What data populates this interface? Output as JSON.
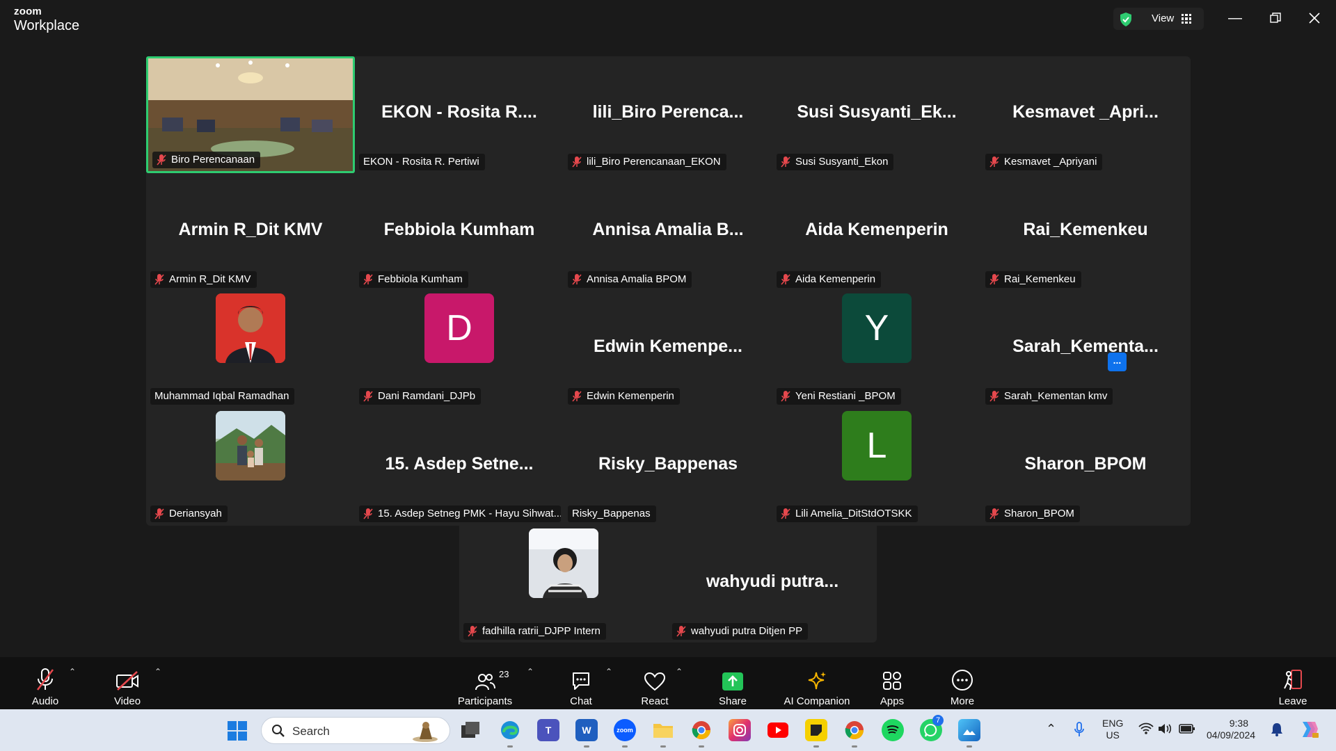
{
  "window": {
    "brand_top": "zoom",
    "brand_bottom": "Workplace",
    "view_label": "View",
    "controls": [
      "minimize",
      "restore",
      "close"
    ]
  },
  "gallery": {
    "tiles": [
      {
        "display": "video",
        "label": "Biro Perencanaan",
        "muted": true,
        "active": true
      },
      {
        "display": "name",
        "big_name": "EKON - Rosita R....",
        "label": "EKON - Rosita R. Pertiwi",
        "muted": false
      },
      {
        "display": "name",
        "big_name": "lili_Biro Perenca...",
        "label": "lili_Biro Perencanaan_EKON",
        "muted": true
      },
      {
        "display": "name",
        "big_name": "Susi Susyanti_Ek...",
        "label": "Susi Susyanti_Ekon",
        "muted": true
      },
      {
        "display": "name",
        "big_name": "Kesmavet _Apri...",
        "label": "Kesmavet _Apriyani",
        "muted": true
      },
      {
        "display": "name",
        "big_name": "Armin R_Dit KMV",
        "label": "Armin R_Dit KMV",
        "muted": true
      },
      {
        "display": "name",
        "big_name": "Febbiola Kumham",
        "label": "Febbiola Kumham",
        "muted": true
      },
      {
        "display": "name",
        "big_name": "Annisa Amalia B...",
        "label": "Annisa Amalia BPOM",
        "muted": true
      },
      {
        "display": "name",
        "big_name": "Aida Kemenperin",
        "label": "Aida Kemenperin",
        "muted": true
      },
      {
        "display": "name",
        "big_name": "Rai_Kemenkeu",
        "label": "Rai_Kemenkeu",
        "muted": true
      },
      {
        "display": "photo",
        "label": "Muhammad Iqbal Ramadhan",
        "muted": false
      },
      {
        "display": "initial",
        "initial": "D",
        "color": "#c8186a",
        "label": "Dani Ramdani_DJPb",
        "muted": true
      },
      {
        "display": "name",
        "big_name": "Edwin Kemenpe...",
        "label": "Edwin Kemenperin",
        "muted": true
      },
      {
        "display": "initial",
        "initial": "Y",
        "color": "#0c4a3a",
        "label": "Yeni Restiani _BPOM",
        "muted": true
      },
      {
        "display": "name",
        "big_name": "Sarah_Kementa...",
        "label": "Sarah_Kementan kmv",
        "muted": true
      },
      {
        "display": "photo",
        "label": "Deriansyah",
        "muted": true
      },
      {
        "display": "name",
        "big_name": "15. Asdep Setne...",
        "label": "15. Asdep Setneg PMK - Hayu Sihwat...",
        "muted": true
      },
      {
        "display": "name",
        "big_name": "Risky_Bappenas",
        "label": "Risky_Bappenas",
        "muted": false
      },
      {
        "display": "initial",
        "initial": "L",
        "color": "#2e7d1c",
        "label": "Lili Amelia_DitStdOTSKK",
        "muted": true
      },
      {
        "display": "name",
        "big_name": "Sharon_BPOM",
        "label": "Sharon_BPOM",
        "muted": true
      },
      {
        "display": "photo",
        "label": "fadhilla ratrii_DJPP Intern",
        "muted": true
      },
      {
        "display": "name",
        "big_name": "wahyudi putra...",
        "label": "wahyudi putra Ditjen PP",
        "muted": true
      }
    ],
    "more_button": "..."
  },
  "toolbar": {
    "audio": "Audio",
    "video": "Video",
    "participants": "Participants",
    "participants_count": "23",
    "chat": "Chat",
    "react": "React",
    "share": "Share",
    "ai_companion": "AI Companion",
    "apps": "Apps",
    "more": "More",
    "leave": "Leave"
  },
  "taskbar": {
    "search_placeholder": "Search",
    "apps": [
      "start",
      "file-explorer-task",
      "edge",
      "teams",
      "word",
      "zoom",
      "files",
      "chrome",
      "instagram",
      "youtube",
      "sticky",
      "chrome-2",
      "spotify",
      "whatsapp",
      "photos"
    ],
    "whatsapp_badge": "7",
    "lang_top": "ENG",
    "lang_bottom": "US",
    "time": "9:38",
    "date": "04/09/2024"
  },
  "colors": {
    "active_border": "#2ecc71",
    "muted_red": "#e5484d",
    "accent_blue": "#0e72ed",
    "share_green": "#23c458"
  }
}
